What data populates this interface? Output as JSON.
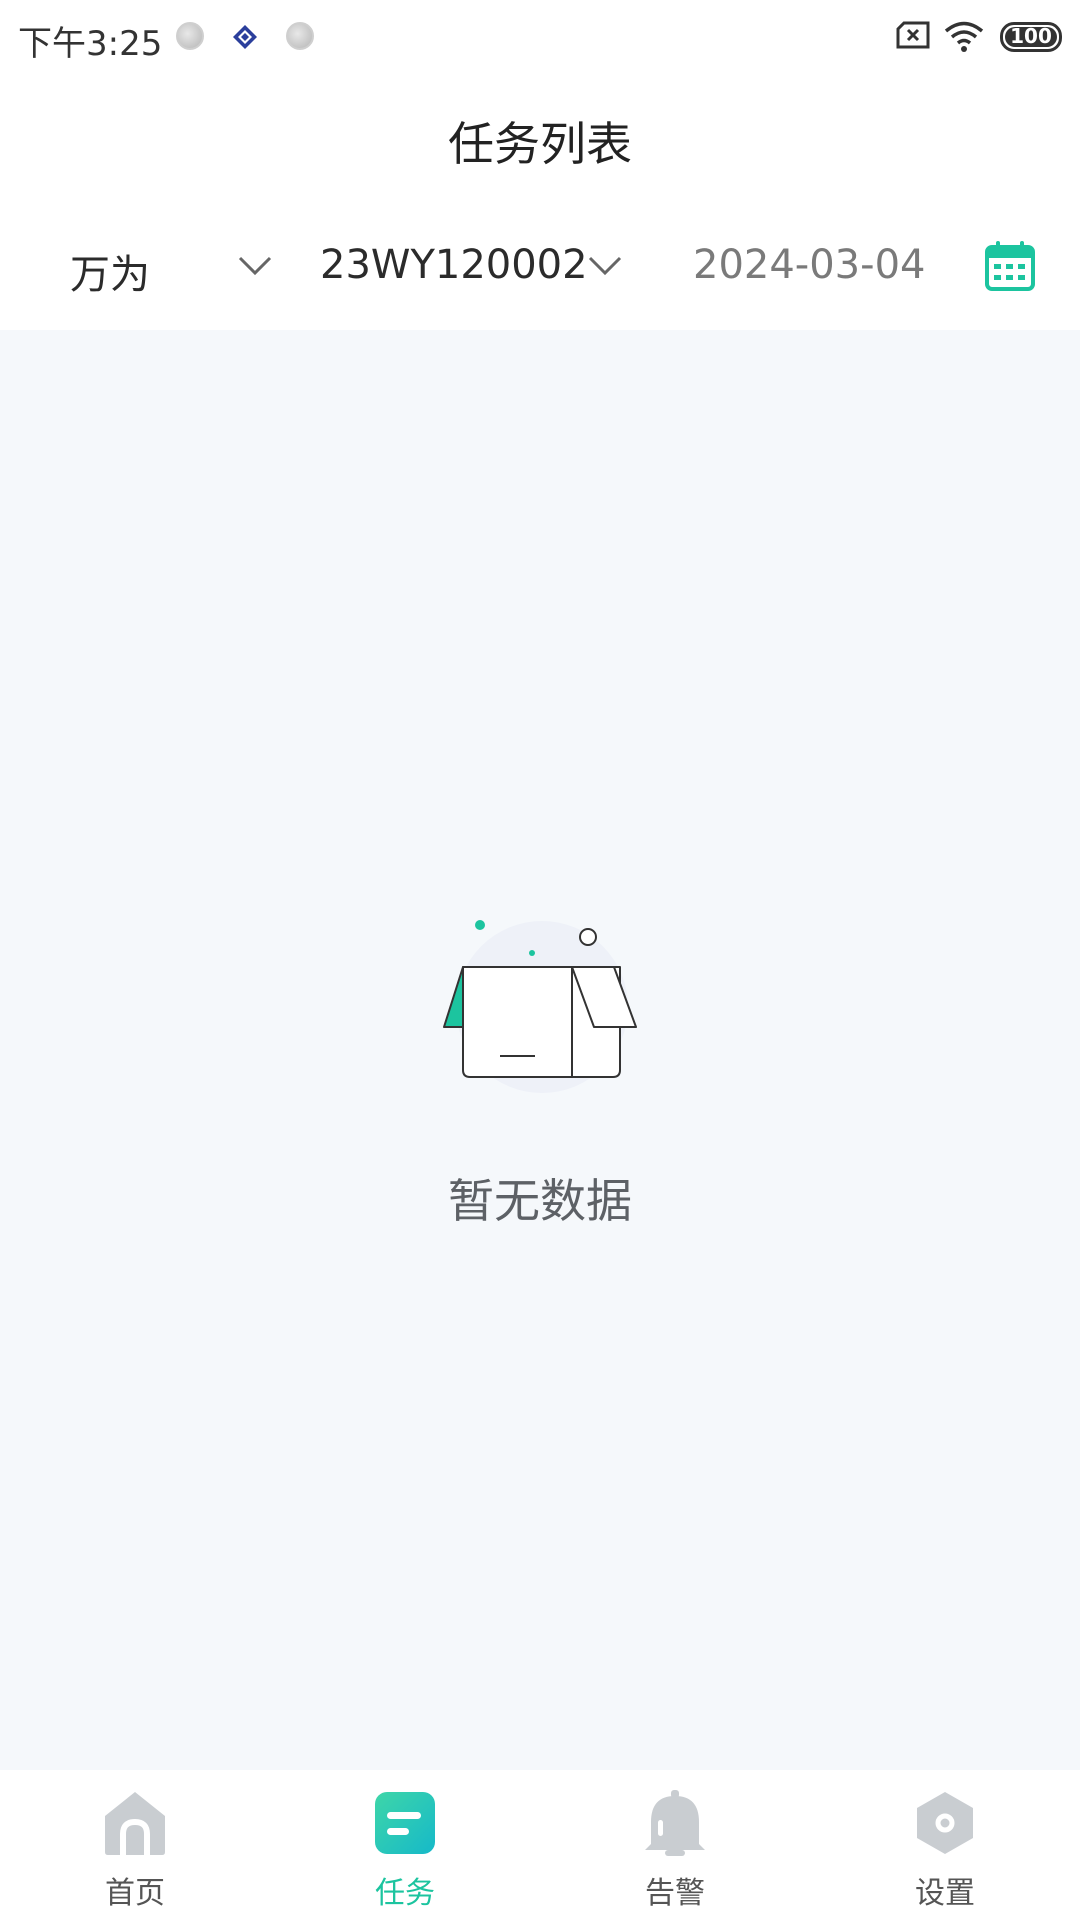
{
  "status_bar": {
    "time": "下午3:25",
    "battery": "100"
  },
  "header": {
    "title": "任务列表"
  },
  "filters": {
    "company": "万为",
    "device": "23WY120002",
    "date": "2024-03-04"
  },
  "empty_state": {
    "message": "暂无数据"
  },
  "bottom_nav": {
    "items": [
      {
        "label": "首页",
        "icon": "home-icon"
      },
      {
        "label": "任务",
        "icon": "task-icon"
      },
      {
        "label": "告警",
        "icon": "bell-icon"
      },
      {
        "label": "设置",
        "icon": "gear-icon"
      }
    ],
    "active_index": 1
  },
  "colors": {
    "accent": "#1cc49f",
    "background": "#f5f8fb",
    "inactive_icon": "#c9cdd1"
  }
}
